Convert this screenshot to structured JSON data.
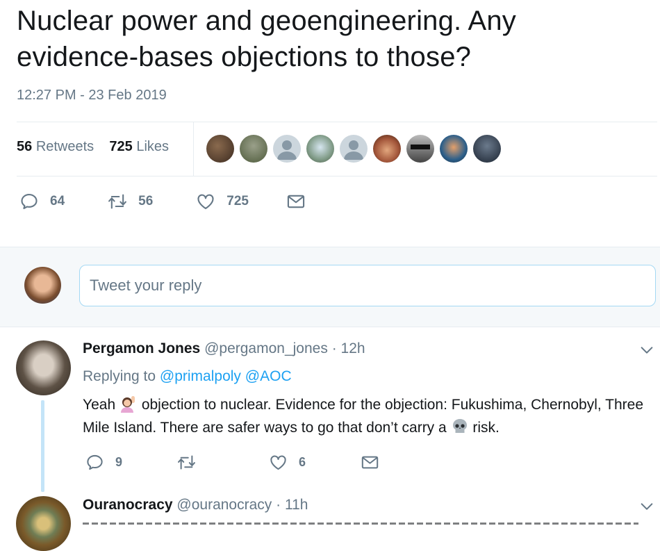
{
  "tweet": {
    "text": "Nuclear power and geoengineering. Any evidence-bases objections to those?",
    "timestamp": "12:27 PM - 23 Feb 2019",
    "retweets_count": "56",
    "retweets_label": "Retweets",
    "likes_count": "725",
    "likes_label": "Likes",
    "actions": {
      "replies": "64",
      "retweets": "56",
      "likes": "725"
    }
  },
  "reply_box": {
    "placeholder": "Tweet your reply"
  },
  "replies": [
    {
      "name": "Pergamon Jones",
      "handle": "@pergamon_jones",
      "time": "· 12h",
      "replying_prefix": "Replying to",
      "replying_to": [
        "@primalpoly",
        "@AOC"
      ],
      "text_part1": "Yeah",
      "text_part2": "objection to nuclear. Evidence for the objection: Fukushima, Chernobyl, Three Mile Island. There are safer ways to go that don’t carry a",
      "text_part3": "risk.",
      "actions": {
        "replies": "9",
        "retweets": "",
        "likes": "6"
      }
    },
    {
      "name": "Ouranocracy",
      "handle": "@ouranocracy",
      "time": "· 11h"
    }
  ],
  "icons": {
    "reply": "reply-icon",
    "retweet": "retweet-icon",
    "like": "heart-icon",
    "dm": "envelope-icon",
    "caret": "chevron-down-icon",
    "emoji_woman": "woman-raising-hand-emoji",
    "emoji_skull": "skull-emoji"
  },
  "colors": {
    "link": "#1da1f2",
    "muted": "#657786",
    "text": "#14171a",
    "border": "#e6ecf0",
    "thread": "#c4e4f8"
  }
}
